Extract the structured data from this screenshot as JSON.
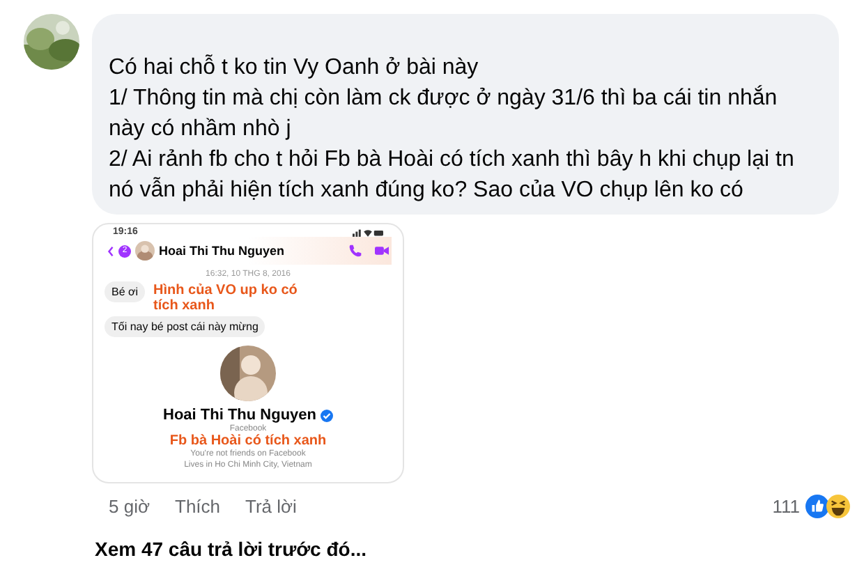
{
  "comment": {
    "lines": [
      "Có hai chỗ t ko tin Vy Oanh ở bài này",
      "1/ Thông tin mà chị còn làm ck được ở ngày 31/6 thì ba cái tin nhắn này có nhầm nhò j",
      "2/ Ai rảnh fb cho t hỏi Fb bà Hoài có tích xanh thì bây h khi chụp lại tn nó vẫn phải hiện tích xanh đúng ko? Sao của VO chụp lên ko có"
    ],
    "screenshot": {
      "status_time": "19:16",
      "back_badge": "2",
      "contact_name": "Hoai Thi Thu Nguyen",
      "timestamp": "16:32, 10 THG 8, 2016",
      "messages": [
        "Bé ơi",
        "Tối nay bé post cái này mừng"
      ],
      "annotations": [
        "Hình của VO up ko có tích xanh",
        "Fb bà Hoài có tích xanh"
      ],
      "profile_name": "Hoai Thi Thu Nguyen",
      "verified": true,
      "profile_source": "Facebook",
      "friend_status": "You're not friends on Facebook",
      "location": "Lives in Ho Chi Minh City, Vietnam"
    },
    "time": "5 giờ",
    "like": "Thích",
    "reply": "Trả lời",
    "reaction_count": "111"
  },
  "more_replies": "Xem 47 câu trả lời trước đó..."
}
